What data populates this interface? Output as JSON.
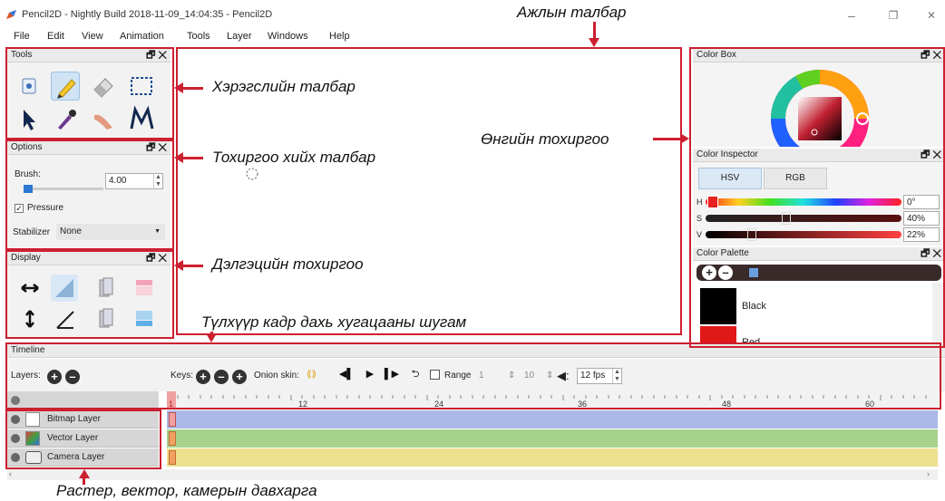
{
  "window": {
    "title": "Pencil2D - Nightly Build 2018-11-09_14:04:35 - Pencil2D",
    "minimize_glyph": "–",
    "restore_glyph": "❐",
    "close_glyph": "✕"
  },
  "menu": [
    "File",
    "Edit",
    "View",
    "Animation",
    "Tools",
    "Layer",
    "Windows",
    "Help"
  ],
  "panels": {
    "tools": {
      "title": "Tools"
    },
    "options": {
      "title": "Options",
      "brush_label": "Brush:",
      "brush_value": "4.00",
      "pressure_label": "Pressure",
      "pressure_checked": true,
      "stabilizer_label": "Stabilizer",
      "stabilizer_value": "None"
    },
    "display": {
      "title": "Display"
    },
    "color_box": {
      "title": "Color Box"
    },
    "color_inspector": {
      "title": "Color Inspector",
      "tab_hsv": "HSV",
      "tab_rgb": "RGB",
      "h_label": "H",
      "h_value": "0°",
      "s_label": "S",
      "s_value": "40%",
      "v_label": "V",
      "v_value": "22%"
    },
    "color_palette": {
      "title": "Color Palette",
      "swatches": [
        {
          "name": "Black",
          "color": "#000000"
        },
        {
          "name": "Red",
          "color": "#e01818"
        }
      ]
    },
    "dock_glyphs": "🗗 ✕"
  },
  "timeline": {
    "title": "Timeline",
    "layers_label": "Layers:",
    "keys_label": "Keys:",
    "onion_label": "Onion skin:",
    "range_label": "Range",
    "range_start": "1",
    "range_end": "10",
    "fps": "12 fps",
    "current_frame": "1",
    "ruler_labels": [
      "12",
      "24",
      "36",
      "48",
      "60"
    ],
    "layers": [
      {
        "name": "Bitmap Layer",
        "color": "#a9b8e6"
      },
      {
        "name": "Vector Layer",
        "color": "#a6d28c"
      },
      {
        "name": "Camera Layer",
        "color": "#ece08e"
      }
    ]
  },
  "annotations": {
    "main_toolbar": "Ажлын талбар",
    "tools_panel": "Хэрэгслийн талбар",
    "options_panel": "Тохиргоо хийх талбар",
    "color_settings": "Өнгийн тохиргоо",
    "display_settings": "Дэлгэцийн тохиргоо",
    "timeline": "Түлхүүр кадр дахь хугацааны шугам",
    "layers": "Растер, вектор, камерын давхарга"
  },
  "colors": {
    "annotation_red": "#cc2030",
    "active_tool": "#cfe3f5"
  }
}
